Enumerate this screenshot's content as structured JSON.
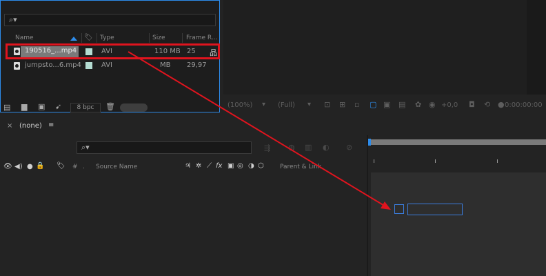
{
  "project": {
    "search_placeholder": "",
    "columns": {
      "name": "Name",
      "type": "Type",
      "size": "Size",
      "frame_rate": "Frame R..."
    },
    "rows": [
      {
        "name": "190516_...mp4",
        "type": "AVI",
        "size": "110 MB",
        "frame_rate": "25"
      },
      {
        "name": "jumpsto...6.mp4",
        "type": "AVI",
        "size": "MB",
        "frame_rate": "29,97"
      }
    ],
    "bit_depth": "8 bpc"
  },
  "viewer": {
    "zoom": "(100%)",
    "resolution": "(Full)",
    "exposure": "+0,0",
    "timecode": "0:00:00:00"
  },
  "timeline": {
    "close_symbol": "×",
    "comp_name": "(none)",
    "menu_symbol": "≡",
    "columns": {
      "hash": "#",
      "dot": ".",
      "source_name": "Source Name",
      "fx": "fx",
      "parent": "Parent & Link"
    }
  },
  "colors": {
    "accent": "#2d8ceb",
    "highlight": "#e0141e",
    "label": "#b4dcd2"
  }
}
